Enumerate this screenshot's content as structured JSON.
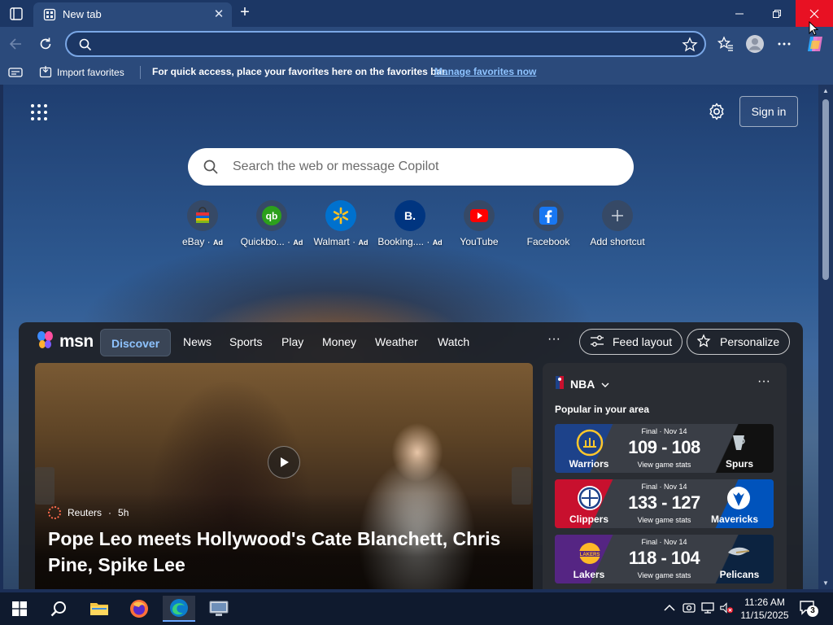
{
  "browser": {
    "tab_title": "New tab",
    "address_value": "",
    "favorites_bar": {
      "import_label": "Import favorites",
      "message": "For quick access, place your favorites here on the favorites bar.",
      "manage_link": "Manage favorites now"
    }
  },
  "newtab": {
    "sign_in": "Sign in",
    "search_placeholder": "Search the web or message Copilot",
    "shortcuts": [
      {
        "label": "eBay",
        "ad": "Ad"
      },
      {
        "label": "Quickbo...",
        "ad": "Ad"
      },
      {
        "label": "Walmart",
        "ad": "Ad"
      },
      {
        "label": "Booking....",
        "ad": "Ad"
      },
      {
        "label": "YouTube",
        "ad": ""
      },
      {
        "label": "Facebook",
        "ad": ""
      },
      {
        "label": "Add shortcut",
        "ad": ""
      }
    ]
  },
  "msn": {
    "brand": "msn",
    "nav": [
      "Discover",
      "News",
      "Sports",
      "Play",
      "Money",
      "Weather",
      "Watch"
    ],
    "more": "···",
    "feed_layout": "Feed layout",
    "personalize": "Personalize",
    "hero": {
      "source": "Reuters",
      "age": "5h",
      "title": "Pope Leo meets Hollywood's Cate Blanchett, Chris Pine, Spike Lee"
    },
    "sports": {
      "league": "NBA",
      "subtitle": "Popular in your area",
      "games": [
        {
          "status": "Final · Nov 14",
          "score": "109 - 108",
          "stats": "View game stats",
          "home": "Warriors",
          "away": "Spurs",
          "home_color": "#1d428a",
          "away_color": "#111111"
        },
        {
          "status": "Final · Nov 14",
          "score": "133 - 127",
          "stats": "View game stats",
          "home": "Clippers",
          "away": "Mavericks",
          "home_color": "#c8102e",
          "away_color": "#0053bc"
        },
        {
          "status": "Final · Nov 14",
          "score": "118 - 104",
          "stats": "View game stats",
          "home": "Lakers",
          "away": "Pelicans",
          "home_color": "#552583",
          "away_color": "#0c2340"
        }
      ]
    }
  },
  "taskbar": {
    "time": "11:26 AM",
    "date": "11/15/2025",
    "notifications": "3"
  }
}
